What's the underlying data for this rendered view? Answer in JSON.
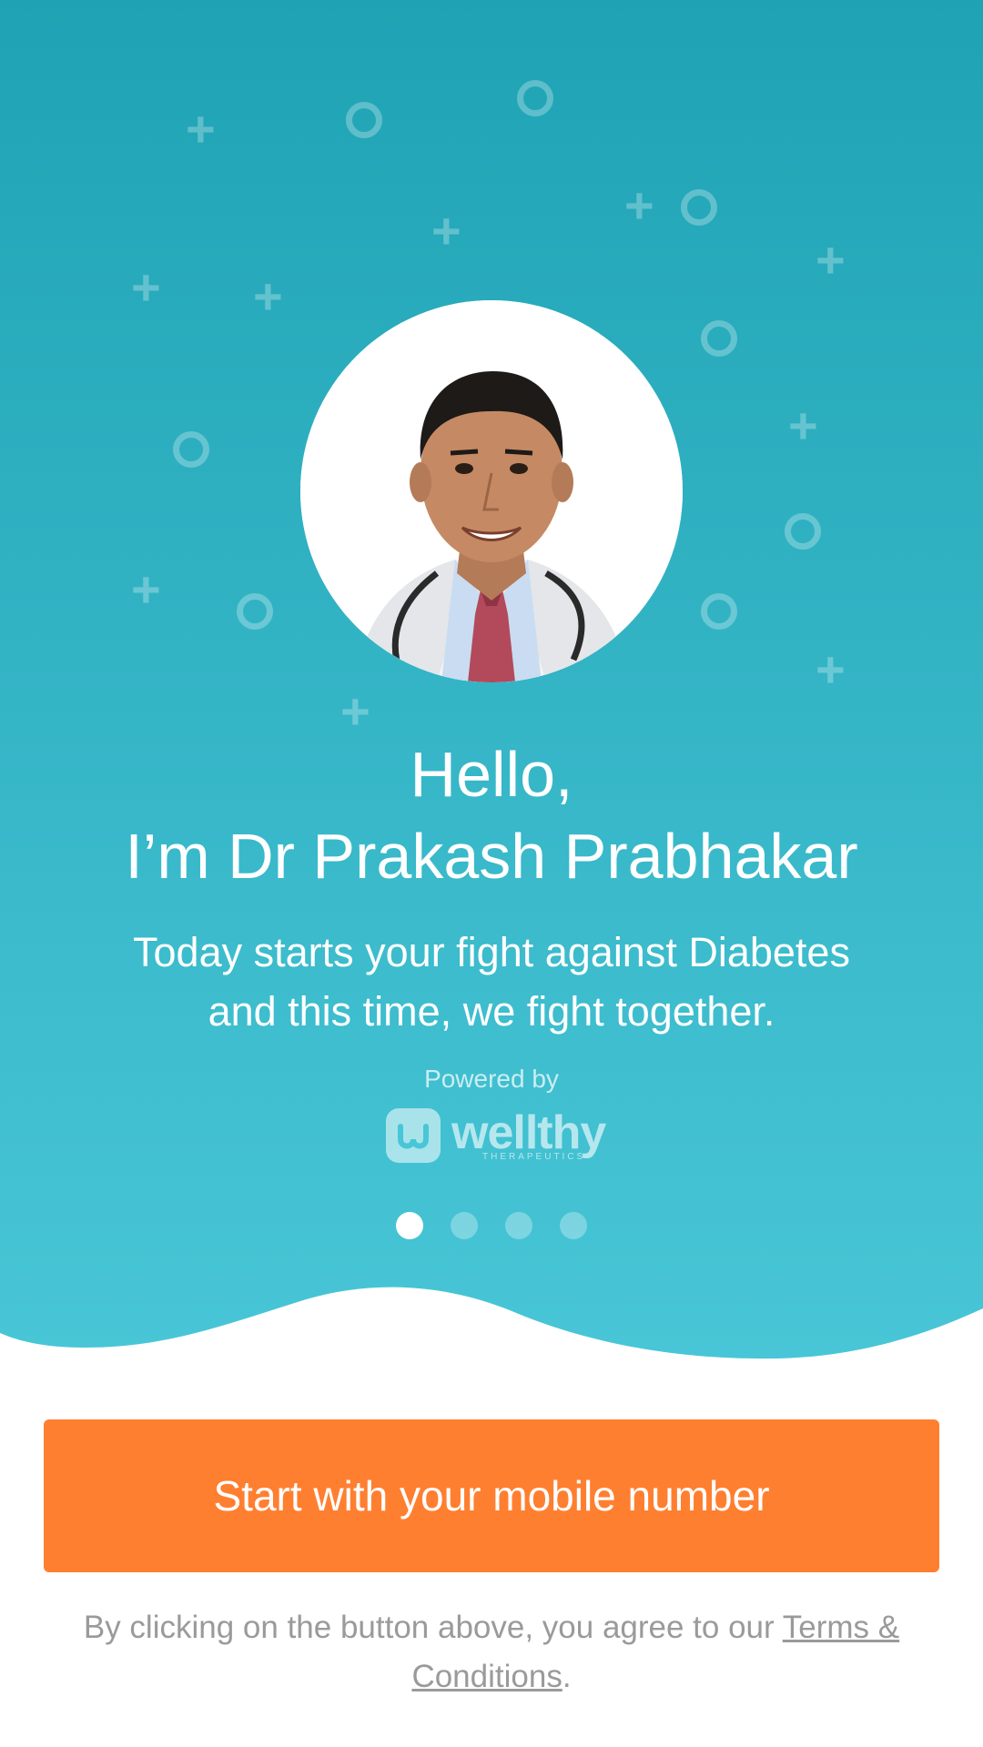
{
  "colors": {
    "gradient_top": "#1fa3b4",
    "gradient_bottom": "#48c6d7",
    "accent": "#ff7f30"
  },
  "onboarding": {
    "greeting_line1": "Hello,",
    "greeting_line2": "I’m Dr Prakash Prabhakar",
    "subtitle_line1": "Today starts your fight against Diabetes",
    "subtitle_line2": "and this time, we fight together.",
    "powered_by": "Powered by",
    "logo_word": "wellthy",
    "logo_tag": "THERAPEUTICS",
    "page_count": 4,
    "active_page": 1
  },
  "cta": {
    "label": "Start with your mobile number"
  },
  "legal": {
    "prefix": "By clicking on the button above, you agree to our ",
    "link": "Terms & Conditions",
    "suffix": "."
  }
}
